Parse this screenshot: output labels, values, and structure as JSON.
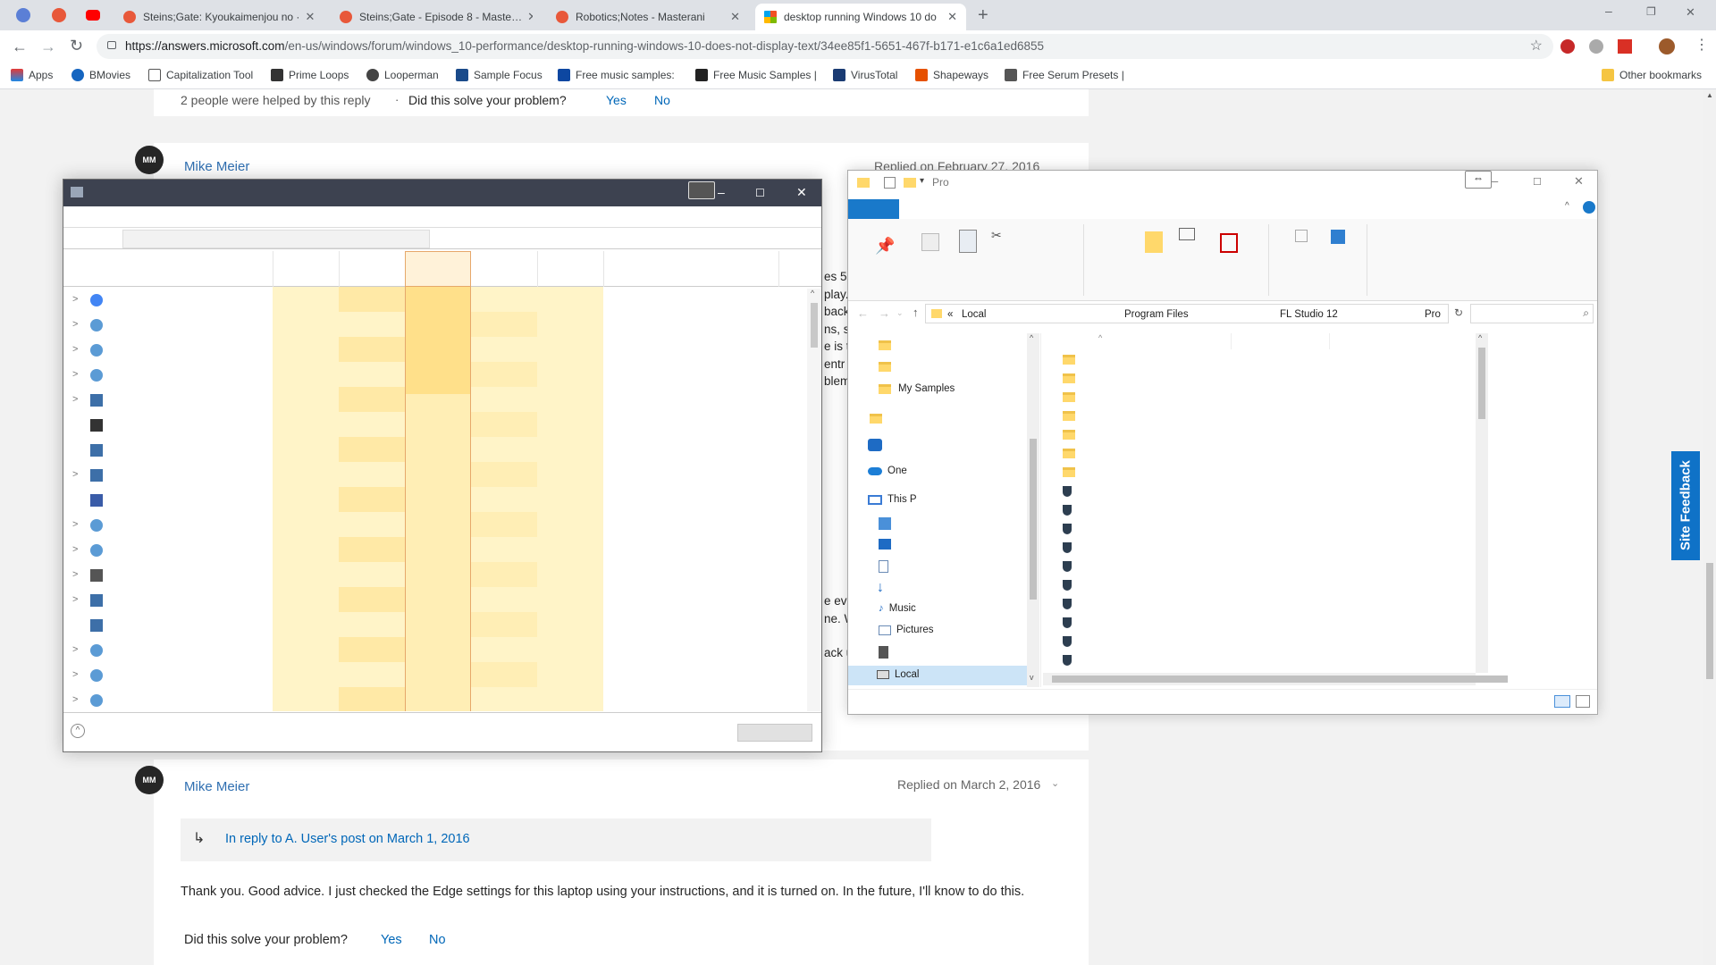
{
  "browser": {
    "tabs": [
      {
        "title": "Steins;Gate: Kyoukaimenjou no ·"
      },
      {
        "title": "Steins;Gate - Episode 8 - Maste…"
      },
      {
        "title": "Robotics;Notes - Masterani"
      },
      {
        "title": "desktop running Windows 10 do"
      }
    ],
    "url_main": "https://answers.microsoft.com",
    "url_rest": "/en-us/windows/forum/windows_10-performance/desktop-running-windows-10-does-not-display-text/34ee85f1-5651-467f-b171-e1c6a1ed6855",
    "bookmarks": [
      "Apps",
      "BMovies",
      "Capitalization Tool",
      "Prime Loops",
      "Looperman",
      "Sample Focus",
      "Free music samples: ",
      "Free Music Samples |",
      "VirusTotal",
      "Shapeways",
      "Free Serum Presets |",
      "Other bookmarks"
    ]
  },
  "page": {
    "helped_text": "2 people were helped by this reply",
    "dot": "·",
    "solve_q": "Did this solve your problem?",
    "yes": "Yes",
    "no": "No",
    "reply1": {
      "initials": "MM",
      "author": "Mike Meier",
      "date": "Replied on February 27, 2016"
    },
    "reply2": {
      "initials": "MM",
      "author": "Mike Meier",
      "date": "Replied on March 2, 2016",
      "in_reply": "In reply to A. User's post on March 1, 2016",
      "body": "Thank you. Good advice. I just checked the Edge settings for this laptop using your instructions, and it is turned on. In the future, I'll know to do this.",
      "solve_q": "Did this solve your problem?",
      "yes": "Yes",
      "no": "No"
    },
    "hidden_fragments": [
      "es 5",
      "play.",
      "back",
      "ns, sc",
      "e is t",
      "entr",
      "blem",
      "e eve",
      "ne. W",
      "ack u"
    ],
    "site_feedback": "Site Feedback"
  },
  "explorer": {
    "title_path": "Pro",
    "breadcrumb": [
      "Local",
      "Program Files",
      "FL Studio 12",
      "Pro"
    ],
    "nav": {
      "my_samples": "My Samples",
      "onedrive": "One",
      "this_pc": "This P",
      "music": "Music",
      "pictures": "Pictures",
      "local": "Local"
    }
  },
  "colors": {
    "accent": "#0067b8",
    "heat_light": "#fff4c8",
    "heat_mid": "#ffe9a6",
    "heat_dark": "#ffd66b",
    "titlebar": "#3d4250"
  },
  "icons": [
    "back-icon",
    "forward-icon",
    "reload-icon",
    "star-icon",
    "folder-icon",
    "shield-icon",
    "gear-icon",
    "chrome-icon"
  ]
}
